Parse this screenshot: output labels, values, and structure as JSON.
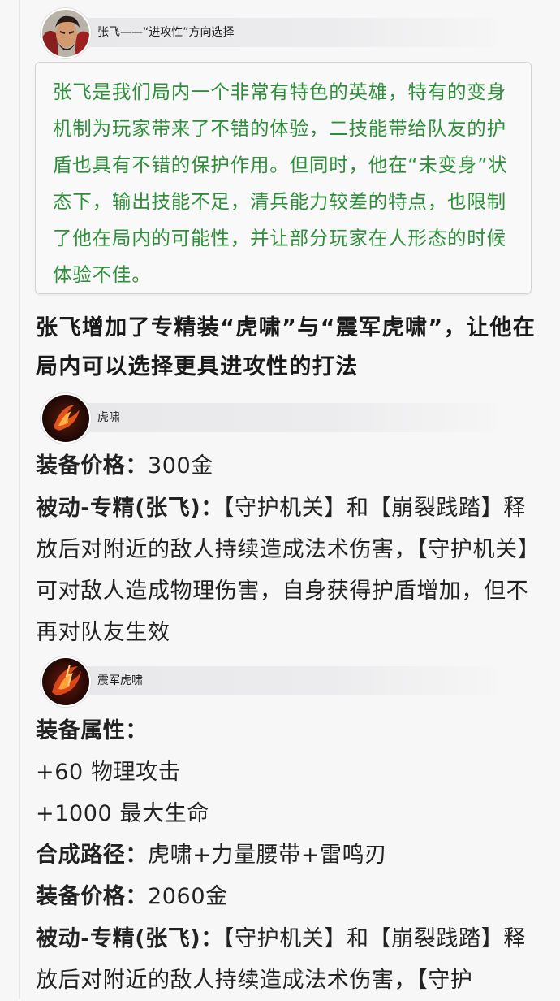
{
  "hero_section": {
    "avatar_icon": "zhangfei-hero-portrait-icon",
    "title": "张飞——“进攻性”方向选择"
  },
  "intro_quote": "张飞是我们局内一个非常有特色的英雄，特有的变身机制为玩家带来了不错的体验，二技能带给队友的护盾也具有不错的保护作用。但同时，他在“未变身”状态下，输出技能不足，清兵能力较差的特点，也限制了他在局内的可能性，并让部分玩家在人形态的时候体验不佳。",
  "headline": "张飞增加了专精装“虎啸”与“震军虎啸”，让他在局内可以选择更具进攻性的打法",
  "item1": {
    "icon": "huxiao-item-icon",
    "name": "虎啸",
    "price_label": "装备价格：",
    "price_value": "300金",
    "passive_label": "被动-专精(张飞)：",
    "passive_text": "【守护机关】和【崩裂践踏】释放后对附近的敌人持续造成法术伤害，【守护机关】可对敌人造成物理伤害，自身获得护盾增加，但不再对队友生效"
  },
  "item2": {
    "icon": "zhenjun-huxiao-item-icon",
    "name": "震军虎啸",
    "attr_label": "装备属性：",
    "attr1": "+60 物理攻击",
    "attr2": "+1000 最大生命",
    "recipe_label": "合成路径：",
    "recipe_value": "虎啸+力量腰带+雷鸣刃",
    "price_label": "装备价格：",
    "price_value": "2060金",
    "passive_label": "被动-专精(张飞)：",
    "passive_text": "【守护机关】和【崩裂践踏】释放后对附近的敌人持续造成法术伤害，【守护"
  }
}
